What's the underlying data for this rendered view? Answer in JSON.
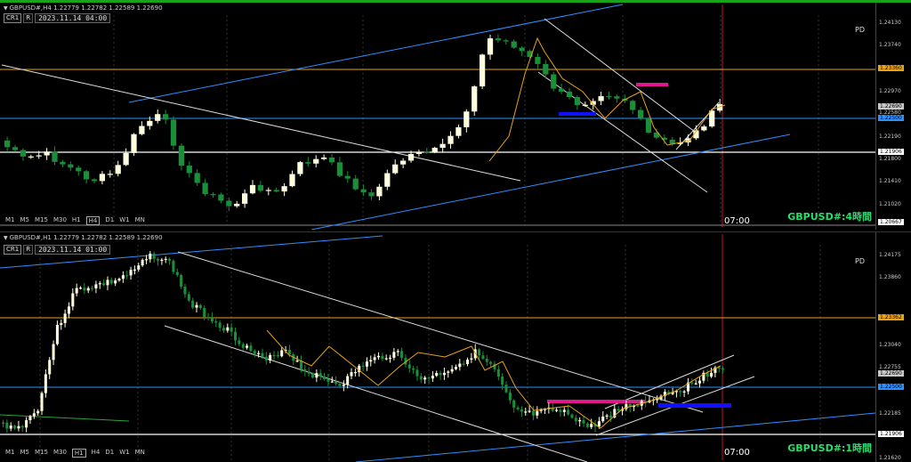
{
  "top": {
    "header": "GBPUSD#,H4  1.22779 1.22782 1.22589 1.22690",
    "btn_cr": "CR1",
    "btn_r": "R",
    "datetime": "2023.11.14 04:00",
    "pd": "PD",
    "title": "GBPUSD#:4時間",
    "time_label": "07:00",
    "timeframes": [
      "M1",
      "M5",
      "M15",
      "M30",
      "H1",
      "H4",
      "D1",
      "W1",
      "MN"
    ],
    "selected_tf": "H4",
    "price_labels": [
      "1.24130",
      "1.23740",
      "1.23360",
      "1.22970",
      "1.22690",
      "1.22580",
      "1.22500",
      "1.22190",
      "1.21906",
      "1.21800",
      "1.21410",
      "1.21020",
      "1.20667"
    ],
    "hl_bid": "1.22690",
    "hl_blue": "1.22500",
    "hl_orange": "1.23360",
    "hl_white": "1.21906",
    "hl_bottom": "1.20667"
  },
  "bottom": {
    "header": "GBPUSD#,H1  1.22779 1.22782 1.22589 1.22690",
    "btn_cr": "CR1",
    "btn_r": "R",
    "datetime": "2023.11.14 01:00",
    "pd": "PD",
    "title": "GBPUSD#:1時間",
    "time_label": "07:00",
    "timeframes": [
      "M1",
      "M5",
      "M15",
      "M30",
      "H1",
      "H4",
      "D1",
      "W1",
      "MN"
    ],
    "selected_tf": "H1",
    "price_labels": [
      "1.24175",
      "1.23860",
      "1.23362",
      "1.23040",
      "1.22755",
      "1.22690",
      "1.22500",
      "1.22185",
      "1.21906",
      "1.21620"
    ],
    "hl_bid": "1.22690",
    "hl_blue": "1.22500",
    "hl_orange": "1.23362",
    "hl_white": "1.21906"
  },
  "colors": {
    "orange": "#e8a317",
    "blue": "#2f8fff",
    "white": "#ffffff",
    "magenta": "#e0188c",
    "darkblue": "#1010ff",
    "up": "#ffffe0",
    "down": "#1a8f3a",
    "title": "#27e06b"
  }
}
